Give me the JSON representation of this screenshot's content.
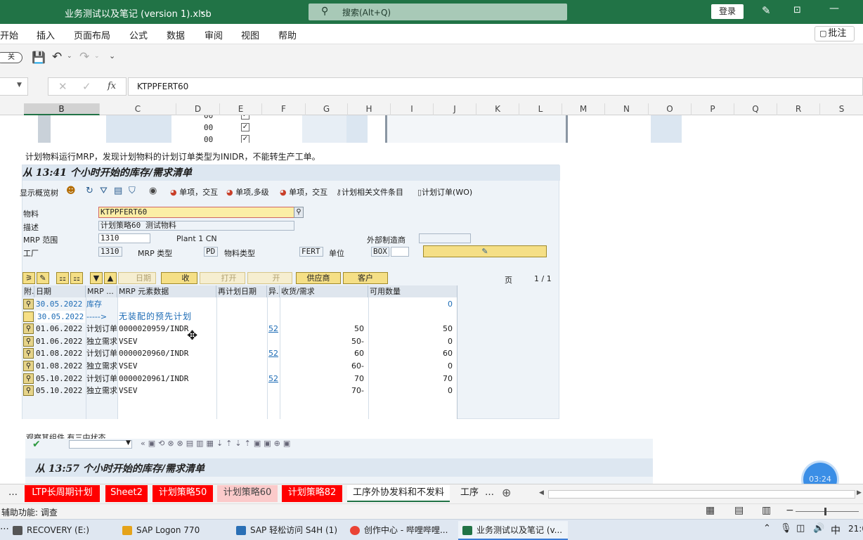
{
  "titlebar": {
    "file_name": "业务测试以及笔记 (version 1).xlsb",
    "search_label": "搜索(Alt+Q)",
    "login_label": "登录"
  },
  "menu": {
    "items": [
      "开始",
      "插入",
      "页面布局",
      "公式",
      "数据",
      "审阅",
      "视图",
      "帮助"
    ],
    "comments_label": "批注"
  },
  "qat": {
    "toggle_label": "关"
  },
  "formula_bar": {
    "fx": "fx",
    "value": "KTPPFERT60"
  },
  "columns": [
    {
      "name": "B",
      "active": true
    },
    {
      "name": "C"
    },
    {
      "name": "D"
    },
    {
      "name": "E"
    },
    {
      "name": "F"
    },
    {
      "name": "G"
    },
    {
      "name": "H"
    },
    {
      "name": "I"
    },
    {
      "name": "J"
    },
    {
      "name": "K"
    },
    {
      "name": "L"
    },
    {
      "name": "M"
    },
    {
      "name": "N"
    },
    {
      "name": "O"
    },
    {
      "name": "P"
    },
    {
      "name": "Q"
    },
    {
      "name": "R"
    },
    {
      "name": "S"
    }
  ],
  "top_rows": [
    {
      "code": "00"
    },
    {
      "code": "00"
    },
    {
      "code": "00"
    }
  ],
  "note1": "计划物料运行MRP，发现计划物料的计划订单类型为INIDR，不能转生产工单。",
  "sap1": {
    "title": "从 13:41 个小时开始的库存/需求清单",
    "toolbar": {
      "show_overview": "显示概览树",
      "single_item_interactive": "单项，交互",
      "single_item_multi": "单项,多级",
      "single_item_interactive_2": "单项，交互",
      "plan_related_files": "计划相关文件条目",
      "planned_order_wo": "计划订单(WO)"
    },
    "fields": {
      "material_label": "物料",
      "material_value": "KTPPFERT60",
      "desc_label": "描述",
      "desc_value": "计划策略60  测试物料",
      "mrp_area_label": "MRP 范围",
      "mrp_area_value": "1310",
      "mrp_area_text": "Plant 1 CN",
      "ext_supplier_label": "外部制造商",
      "plant_label": "工厂",
      "plant_value": "1310",
      "mrp_type_label": "MRP 类型",
      "mrp_type_value": "PD",
      "material_type_label": "物料类型",
      "material_type_value": "FERT",
      "unit_label": "单位",
      "unit_value": "BOX"
    },
    "btn2": {
      "date": "日期",
      "receive": "收",
      "open": "打开",
      "open2": "开",
      "supplier": "供应商",
      "customer": "客户",
      "page_label": "页",
      "page_value": "1  /  1"
    },
    "table": {
      "headers": [
        "附.",
        "日期",
        "MRP ...",
        "MRP 元素数据",
        "再计划日期",
        "异.",
        "收货/需求",
        "可用数量"
      ],
      "rows": [
        {
          "date": "30.05.2022",
          "elem": "库存",
          "data": "",
          "resched": "",
          "exc": "",
          "qty": "",
          "avail": "0",
          "blue": true
        },
        {
          "date": "30.05.2022",
          "elem": "----->",
          "data": "无装配的预先计划",
          "resched": "",
          "exc": "",
          "qty": "",
          "avail": "",
          "blue": true,
          "yellow": true
        },
        {
          "date": "01.06.2022",
          "elem": "计划订单",
          "data": "0000020959/INDR",
          "resched": "",
          "exc": "52",
          "qty": "50",
          "avail": "50"
        },
        {
          "date": "01.06.2022",
          "elem": "独立需求",
          "data": "VSEV",
          "resched": "",
          "exc": "",
          "qty": "50-",
          "avail": "0"
        },
        {
          "date": "01.08.2022",
          "elem": "计划订单",
          "data": "0000020960/INDR",
          "resched": "",
          "exc": "52",
          "qty": "60",
          "avail": "60"
        },
        {
          "date": "01.08.2022",
          "elem": "独立需求",
          "data": "VSEV",
          "resched": "",
          "exc": "",
          "qty": "60-",
          "avail": "0"
        },
        {
          "date": "05.10.2022",
          "elem": "计划订单",
          "data": "0000020961/INDR",
          "resched": "",
          "exc": "52",
          "qty": "70",
          "avail": "70"
        },
        {
          "date": "05.10.2022",
          "elem": "独立需求",
          "data": "VSEV",
          "resched": "",
          "exc": "",
          "qty": "70-",
          "avail": "0"
        }
      ]
    }
  },
  "note2": "观察其组件,有三中状态",
  "sap2": {
    "title": "从 13:57 个小时开始的库存/需求清单"
  },
  "timer": "03:24",
  "sheets": [
    {
      "name": "LTP长周期计划",
      "style": "red"
    },
    {
      "name": "Sheet2",
      "style": "red"
    },
    {
      "name": "计划策略50",
      "style": "red"
    },
    {
      "name": "计划策略60",
      "style": "pink"
    },
    {
      "name": "计划策略82",
      "style": "red"
    },
    {
      "name": "工序外协发料和不发料",
      "style": "active"
    },
    {
      "name": "工序",
      "style": "plain"
    }
  ],
  "status": {
    "text": "辅助功能: 调查"
  },
  "taskbar": {
    "items": [
      {
        "label": "RECOVERY (E:)",
        "color": "#555555"
      },
      {
        "label": "SAP Logon 770",
        "color": "#e5a31a"
      },
      {
        "label": "SAP 轻松访问 S4H (1)",
        "color": "#2a6fb5"
      },
      {
        "label": "创作中心 - 哔哩哔哩...",
        "color": "#ea4335"
      },
      {
        "label": "业务测试以及笔记 (v...",
        "color": "#217346"
      }
    ],
    "ime": "中",
    "clock": "21:0"
  }
}
